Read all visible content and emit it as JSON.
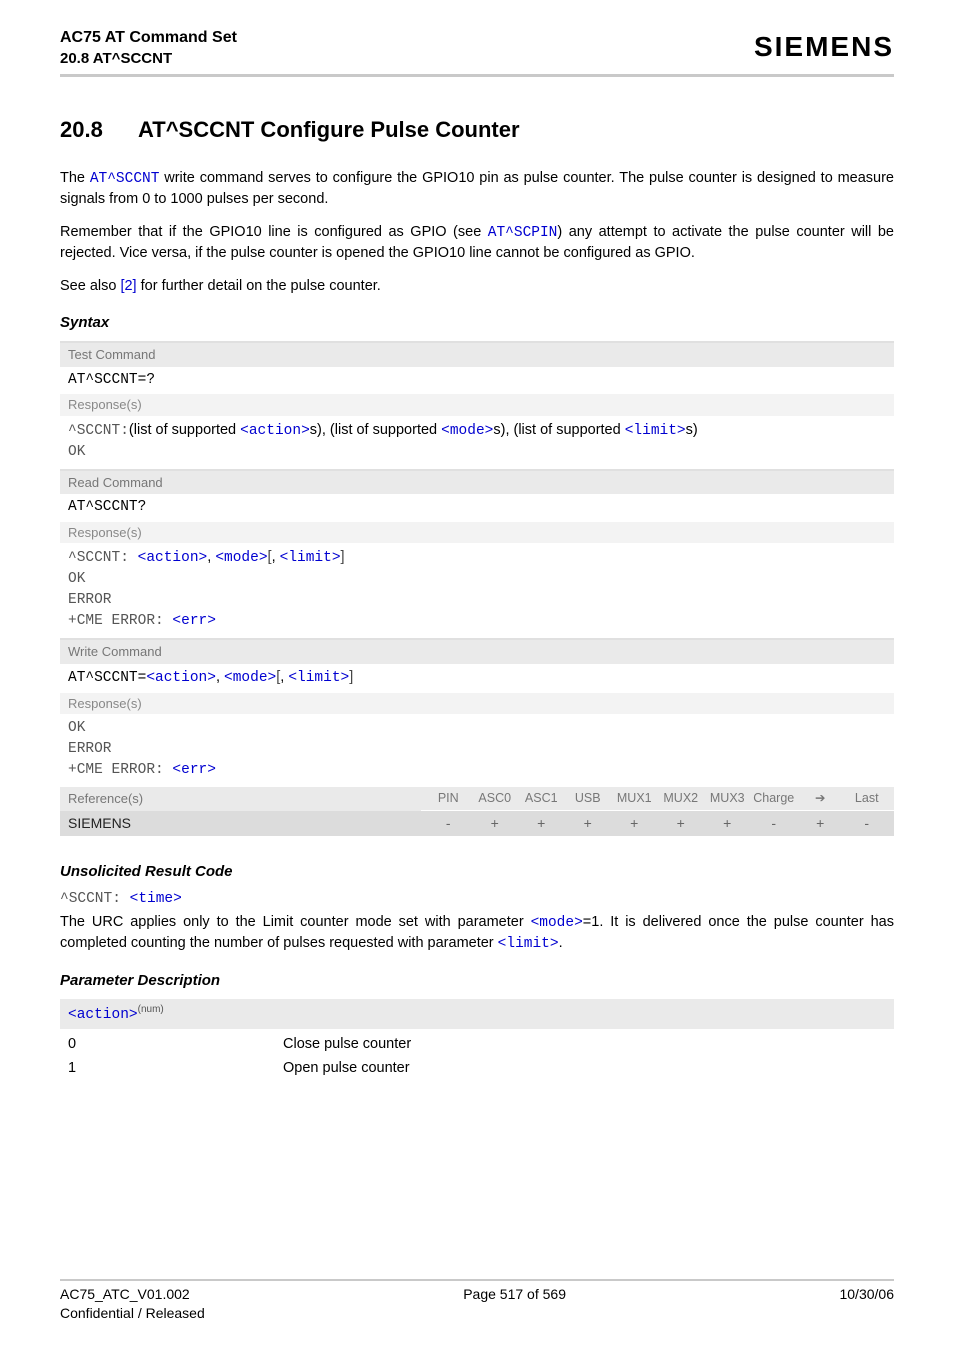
{
  "header": {
    "doc_title": "AC75 AT Command Set",
    "section_ref": "20.8 AT^SCCNT",
    "brand": "SIEMENS"
  },
  "section": {
    "number": "20.8",
    "title": "AT^SCCNT   Configure Pulse Counter"
  },
  "body": {
    "p1_a": "The ",
    "p1_cmd": "AT^SCCNT",
    "p1_b": " write command serves to configure the GPIO10 pin as pulse counter. The pulse counter is designed to measure signals from 0 to 1000 pulses per second.",
    "p2_a": "Remember that if the GPIO10 line is configured as GPIO (see ",
    "p2_cmd": "AT^SCPIN",
    "p2_b": ") any attempt to activate the pulse counter will be rejected. Vice versa, if the pulse counter is opened the GPIO10 line cannot be configured as GPIO.",
    "p3_a": "See also ",
    "p3_ref": "[2]",
    "p3_b": " for further detail on the pulse counter."
  },
  "syntax_label": "Syntax",
  "syntax": {
    "test": {
      "hdr": "Test Command",
      "cmd": "AT^SCCNT=?",
      "resp_lbl": "Response(s)",
      "resp_prefix": "^SCCNT:",
      "resp_t1": "(list of supported ",
      "resp_a": "<action>",
      "resp_t2": "s), (list of supported ",
      "resp_m": "<mode>",
      "resp_t3": "s), (list of supported ",
      "resp_l": "<limit>",
      "resp_t4": "s)",
      "ok": "OK"
    },
    "read": {
      "hdr": "Read Command",
      "cmd": "AT^SCCNT?",
      "resp_lbl": "Response(s)",
      "resp_prefix": "^SCCNT: ",
      "resp_a": "<action>",
      "resp_c1": ", ",
      "resp_m": "<mode>",
      "resp_b1": "[",
      "resp_c2": ", ",
      "resp_l": "<limit>",
      "resp_b2": "]",
      "ok": "OK",
      "error": "ERROR",
      "cme_pre": "+CME ERROR: ",
      "cme_err": "<err>"
    },
    "write": {
      "hdr": "Write Command",
      "cmd_pre": "AT^SCCNT=",
      "cmd_a": "<action>",
      "cmd_c1": ", ",
      "cmd_m": "<mode>",
      "cmd_b1": "[",
      "cmd_c2": ", ",
      "cmd_l": "<limit>",
      "cmd_b2": "]",
      "resp_lbl": "Response(s)",
      "ok": "OK",
      "error": "ERROR",
      "cme_pre": "+CME ERROR: ",
      "cme_err": "<err>"
    }
  },
  "ref": {
    "lbl": "Reference(s)",
    "cols": [
      "PIN",
      "ASC0",
      "ASC1",
      "USB",
      "MUX1",
      "MUX2",
      "MUX3",
      "Charge",
      "➔",
      "Last"
    ],
    "vendor": "SIEMENS",
    "vals": [
      "-",
      "+",
      "+",
      "+",
      "+",
      "+",
      "+",
      "-",
      "+",
      "-"
    ]
  },
  "urc": {
    "heading": "Unsolicited Result Code",
    "line_pre": "^SCCNT: ",
    "line_param": "<time>",
    "desc_a": "The URC applies only to the Limit counter mode set with parameter ",
    "desc_mode": "<mode>",
    "desc_b": "=1. It is delivered once the pulse counter has completed counting the number of pulses requested with parameter ",
    "desc_limit": "<limit>",
    "desc_c": "."
  },
  "params": {
    "heading": "Parameter Description",
    "action": {
      "name": "<action>",
      "sup": "(num)",
      "rows": [
        {
          "val": "0",
          "desc": "Close pulse counter"
        },
        {
          "val": "1",
          "desc": "Open pulse counter"
        }
      ]
    }
  },
  "footer": {
    "left1": "AC75_ATC_V01.002",
    "left2": "Confidential / Released",
    "center": "Page 517 of 569",
    "right": "10/30/06"
  }
}
